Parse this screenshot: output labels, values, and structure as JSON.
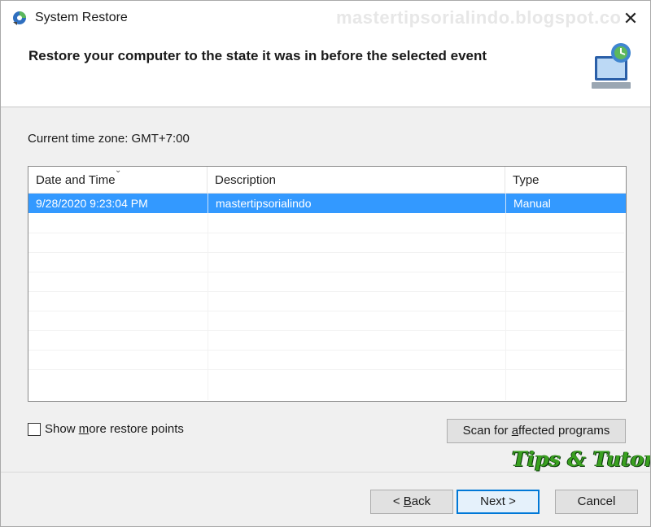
{
  "window": {
    "title": "System Restore",
    "watermark": "mastertipsorialindo.blogspot.co",
    "close_glyph": "✕"
  },
  "header": {
    "text": "Restore your computer to the state it was in before the selected event",
    "icon": "system-restore-monitor-icon"
  },
  "timezone": {
    "text": "Current time zone: GMT+7:00"
  },
  "table": {
    "columns": [
      "Date and Time",
      "Description",
      "Type"
    ],
    "rows": [
      {
        "date": "9/28/2020 9:23:04 PM",
        "description": "mastertipsorialindo",
        "type": "Manual",
        "selected": true
      }
    ]
  },
  "checkbox": {
    "label_pre": "Show ",
    "label_accel": "m",
    "label_post": "ore restore points",
    "checked": false
  },
  "buttons": {
    "scan_pre": "Scan for ",
    "scan_accel": "a",
    "scan_post": "ffected programs",
    "back_pre": "< ",
    "back_accel": "B",
    "back_post": "ack",
    "next_label": "Next >",
    "cancel_label": "Cancel"
  },
  "brand": {
    "text": "Tips & Tutorial"
  },
  "colors": {
    "selection": "#3399ff",
    "brand_green": "#3aa020",
    "primary_border": "#0078d7"
  }
}
